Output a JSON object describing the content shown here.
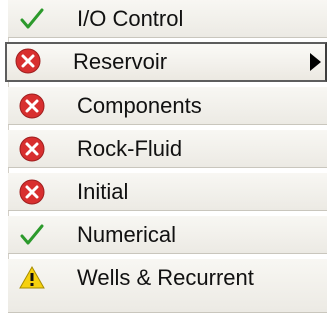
{
  "menu": {
    "items": [
      {
        "label": "I/O Control",
        "icon": "green-check-icon",
        "status": "complete"
      },
      {
        "label": "Reservoir",
        "icon": "red-x-icon",
        "status": "error",
        "selected": true,
        "has_submenu": true
      },
      {
        "label": "Components",
        "icon": "red-x-icon",
        "status": "error"
      },
      {
        "label": "Rock-Fluid",
        "icon": "red-x-icon",
        "status": "error"
      },
      {
        "label": "Initial",
        "icon": "red-x-icon",
        "status": "error"
      },
      {
        "label": "Numerical",
        "icon": "green-check-icon",
        "status": "complete"
      },
      {
        "label": "Wells & Recurrent",
        "icon": "yellow-warning-icon",
        "status": "warning"
      }
    ]
  },
  "colors": {
    "check": "#2c9a2c",
    "error": "#d82f2f",
    "warning": "#f6d10f"
  }
}
